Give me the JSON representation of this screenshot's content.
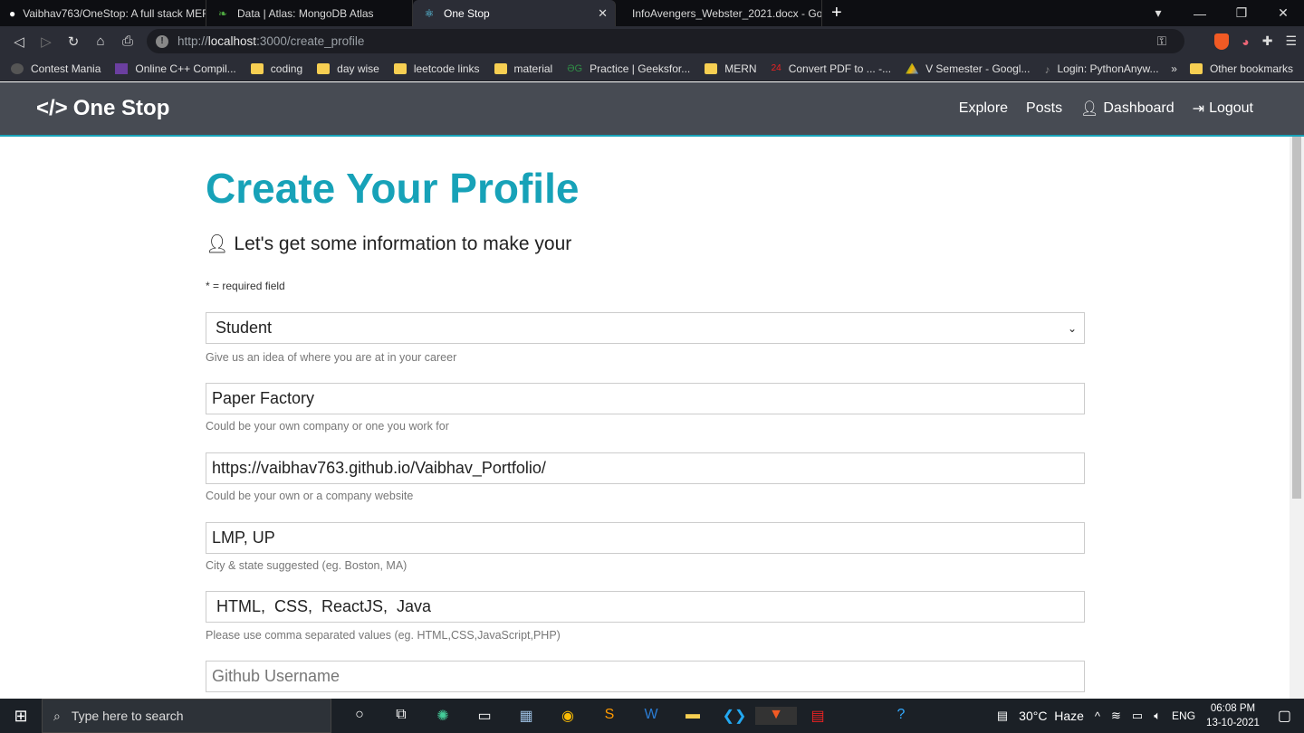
{
  "browser": {
    "tabs": [
      {
        "label": "Vaibhav763/OneStop: A full stack MER",
        "icon": "github-icon"
      },
      {
        "label": "Data | Atlas: MongoDB Atlas",
        "icon": "mongodb-leaf-icon"
      },
      {
        "label": "One Stop",
        "icon": "react-icon",
        "active": true
      },
      {
        "label": "InfoAvengers_Webster_2021.docx - Go",
        "icon": "google-docs-icon"
      }
    ],
    "url_host": "localhost",
    "url_prefix": "http://",
    "url_suffix": ":3000/create_profile",
    "bookmarks": [
      "Contest Mania",
      "Online C++ Compil...",
      "coding",
      "day wise",
      "leetcode links",
      "material",
      "Practice | Geeksfor...",
      "MERN",
      "Convert PDF to ... -...",
      "V Semester - Googl...",
      "Login: PythonAnyw..."
    ],
    "other_bookmarks": "Other bookmarks"
  },
  "navbar": {
    "brand": "One Stop",
    "links": [
      "Explore",
      "Posts",
      "Dashboard",
      "Logout"
    ]
  },
  "page": {
    "title": "Create Your Profile",
    "lead": "Let's get some information to make your",
    "required_note": "* = required field",
    "status": {
      "value": "Student",
      "help": "Give us an idea of where you are at in your career"
    },
    "company": {
      "value": "Paper Factory",
      "help": "Could be your own company or one you work for"
    },
    "website": {
      "value": "https://vaibhav763.github.io/Vaibhav_Portfolio/",
      "help": "Could be your own or a company website"
    },
    "location": {
      "value": "LMP, UP",
      "help": "City & state suggested (eg. Boston, MA)"
    },
    "skills": {
      "value": " HTML,  CSS,  ReactJS,  Java",
      "help": "Please use comma separated values (eg. HTML,CSS,JavaScript,PHP)"
    },
    "github": {
      "placeholder": "Github Username"
    }
  },
  "taskbar": {
    "search_placeholder": "Type here to search",
    "weather": "30°C  Haze",
    "lang": "ENG",
    "time": "06:08 PM",
    "date": "13-10-2021"
  },
  "colors": {
    "accent": "#17a2b8",
    "navbar": "#474b53"
  }
}
